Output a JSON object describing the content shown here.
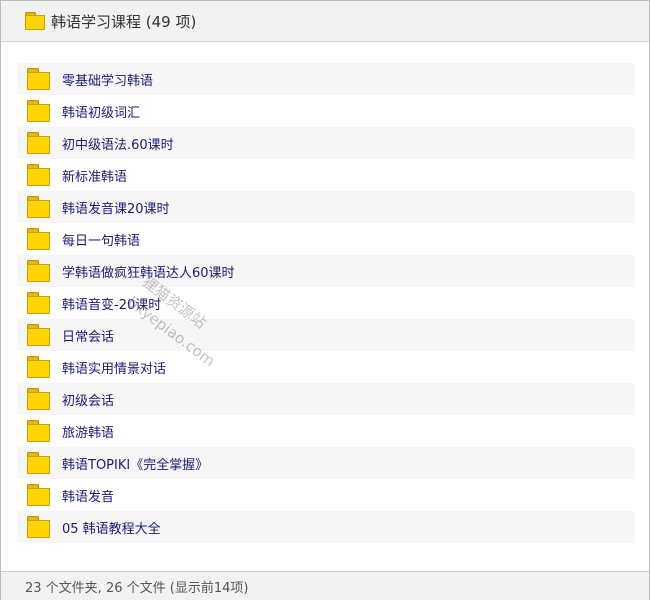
{
  "window": {
    "title": "韩语学习课程 (49 项)"
  },
  "items": [
    {
      "label": "零基础学习韩语"
    },
    {
      "label": "韩语初级词汇"
    },
    {
      "label": "初中级语法.60课时"
    },
    {
      "label": "新标准韩语"
    },
    {
      "label": "韩语发音课20课时"
    },
    {
      "label": "每日一句韩语"
    },
    {
      "label": "学韩语做疯狂韩语达人60课时"
    },
    {
      "label": "韩语音变-20课时"
    },
    {
      "label": "日常会话"
    },
    {
      "label": "韩语实用情景对话"
    },
    {
      "label": "初级会话"
    },
    {
      "label": "旅游韩语"
    },
    {
      "label": "韩语TOPIKI《完全掌握》"
    },
    {
      "label": "韩语发音"
    },
    {
      "label": "05 韩语教程大全"
    }
  ],
  "watermark": {
    "line1": "狸猫资源站",
    "line2": "bkyepiao.com"
  },
  "status": {
    "text": "23 个文件夹, 26 个文件 (显示前14项)"
  },
  "colors": {
    "folder": "#ffd400",
    "label": "#1a1a7a"
  }
}
